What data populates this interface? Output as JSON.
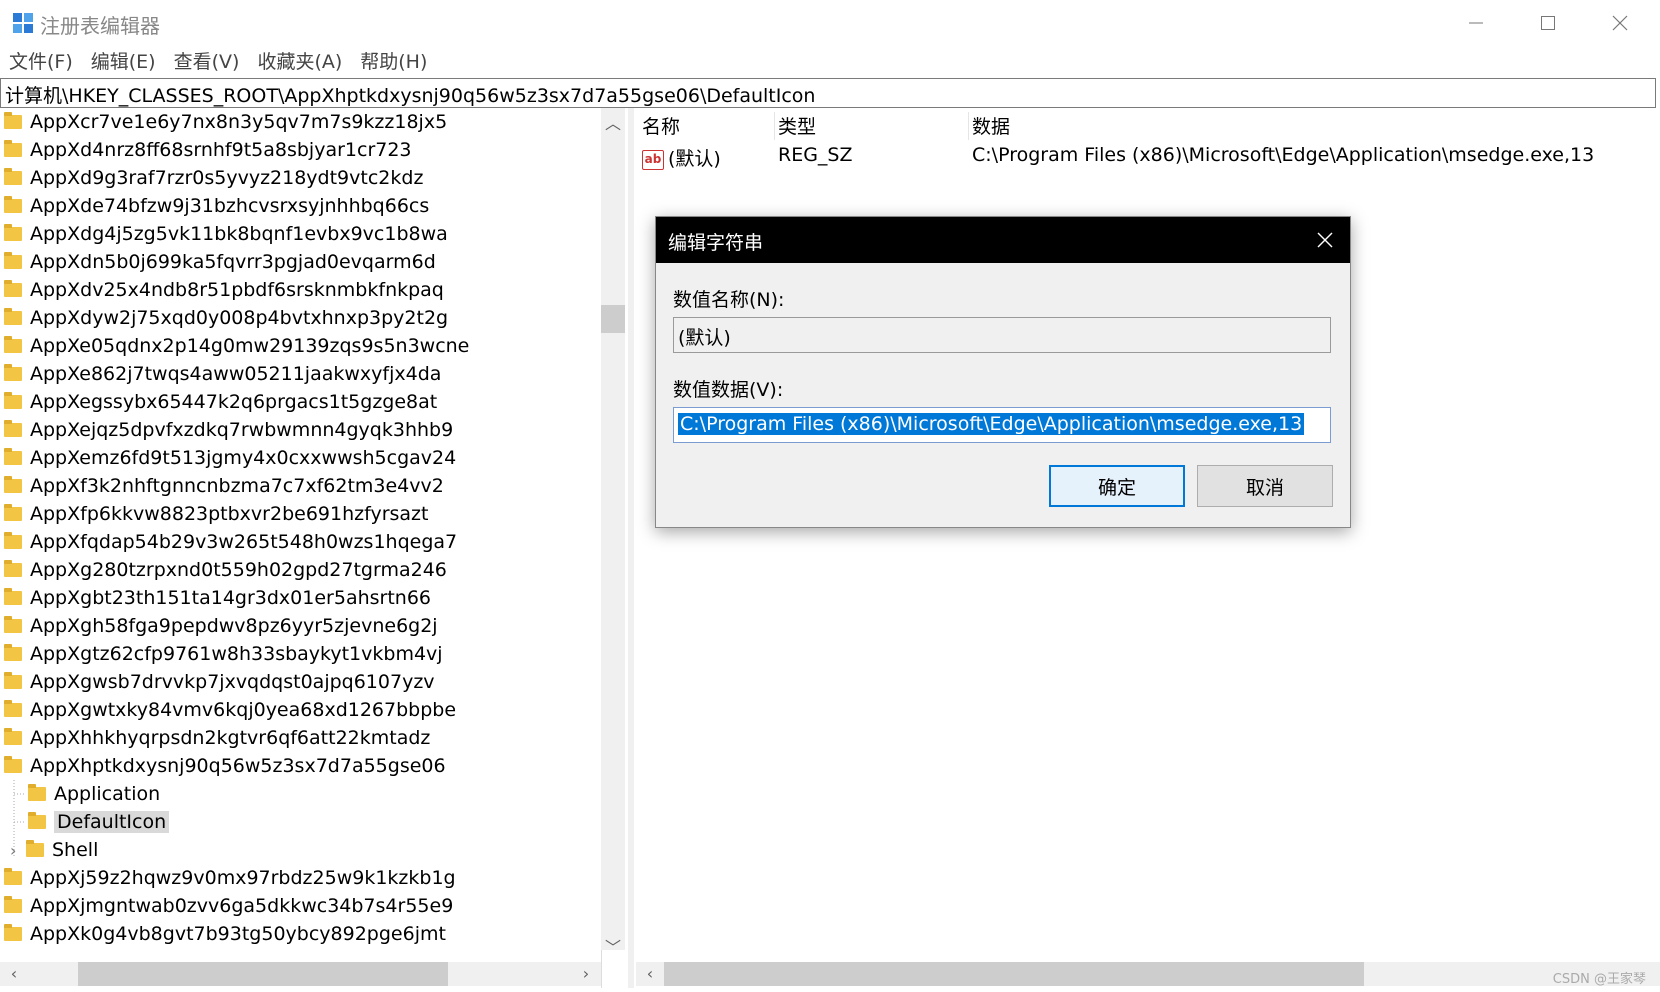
{
  "window": {
    "title": "注册表编辑器"
  },
  "menu": [
    "文件(F)",
    "编辑(E)",
    "查看(V)",
    "收藏夹(A)",
    "帮助(H)"
  ],
  "address": "计算机\\HKEY_CLASSES_ROOT\\AppXhptkdxysnj90q56w5z3sx7d7a55gse06\\DefaultIcon",
  "tree": {
    "items": [
      "AppXcr7ve1e6y7nx8n3y5qv7m7s9kzz18jx5",
      "AppXd4nrz8ff68srnhf9t5a8sbjyar1cr723",
      "AppXd9g3raf7rzr0s5yvyz218ydt9vtc2kdz",
      "AppXde74bfzw9j31bzhcvsrxsyjnhhbq66cs",
      "AppXdg4j5zg5vk11bk8bqnf1evbx9vc1b8wa",
      "AppXdn5b0j699ka5fqvrr3pgjad0evqarm6d",
      "AppXdv25x4ndb8r51pbdf6srsknmbkfnkpaq",
      "AppXdyw2j75xqd0y008p4bvtxhnxp3py2t2g",
      "AppXe05qdnx2p14g0mw29139zqs9s5n3wcne",
      "AppXe862j7twqs4aww05211jaakwxyfjx4da",
      "AppXegssybx65447k2q6prgacs1t5gzge8at",
      "AppXejqz5dpvfxzdkq7rwbwmnn4gyqk3hhb9",
      "AppXemz6fd9t513jgmy4x0cxxwwsh5cgav24",
      "AppXf3k2nhftgnncnbzma7c7xf62tm3e4vv2",
      "AppXfp6kkvw8823ptbxvr2be691hzfyrsazt",
      "AppXfqdap54b29v3w265t548h0wzs1hqega7",
      "AppXg280tzrpxnd0t559h02gpd27tgrma246",
      "AppXgbt23th151ta14gr3dx01er5ahsrtn66",
      "AppXgh58fga9pepdwv8pz6yyr5zjevne6g2j",
      "AppXgtz62cfp9761w8h33sbaykyt1vkbm4vj",
      "AppXgwsb7drvvkp7jxvqdqst0ajpq6107yzv",
      "AppXgwtxky84vmv6kqj0yea68xd1267bbpbe",
      "AppXhhkhyqrpsdn2kgtvr6qf6att22kmtadz",
      "AppXhptkdxysnj90q56w5z3sx7d7a55gse06"
    ],
    "children": [
      "Application",
      "DefaultIcon",
      "Shell"
    ],
    "items_after": [
      "AppXj59z2hqwz9v0mx97rbdz25w9k1kzkb1g",
      "AppXjmgntwab0zvv6ga5dkkwc34b7s4r55e9",
      "AppXk0g4vb8gvt7b93tg50ybcy892pge6jmt"
    ]
  },
  "list": {
    "headers": [
      "名称",
      "类型",
      "数据"
    ],
    "rows": [
      {
        "name": "(默认)",
        "type": "REG_SZ",
        "data": "C:\\Program Files (x86)\\Microsoft\\Edge\\Application\\msedge.exe,13",
        "icon": "ab-icon"
      }
    ]
  },
  "dialog": {
    "title": "编辑字符串",
    "name_label": "数值名称(N):",
    "name_value": "(默认)",
    "data_label": "数值数据(V):",
    "data_value": "C:\\Program Files (x86)\\Microsoft\\Edge\\Application\\msedge.exe,13",
    "ok_label": "确定",
    "cancel_label": "取消"
  },
  "watermark": "CSDN @王家琴"
}
